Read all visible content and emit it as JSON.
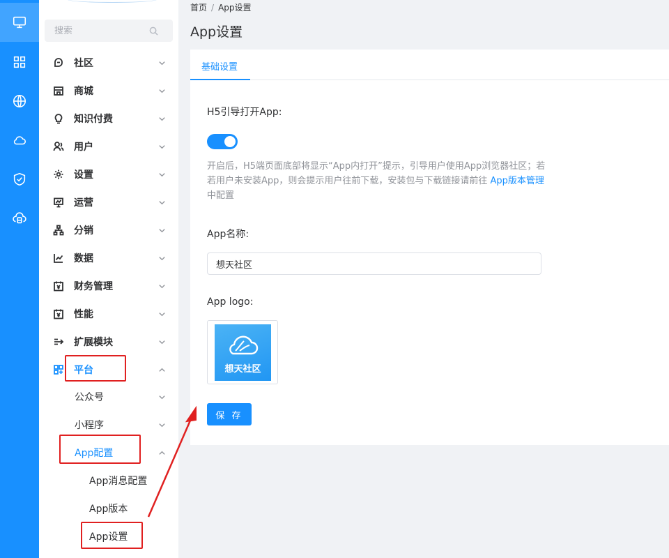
{
  "rail": {
    "items": [
      {
        "icon": "monitor-icon",
        "active": true
      },
      {
        "icon": "grid-icon"
      },
      {
        "icon": "globe-icon"
      },
      {
        "icon": "cloud-icon"
      },
      {
        "icon": "shield-check-icon"
      },
      {
        "icon": "cloud-server-icon"
      }
    ]
  },
  "sidebar": {
    "search_placeholder": "搜索",
    "items": [
      {
        "label": "社区",
        "icon": "chat-bubble-icon"
      },
      {
        "label": "商城",
        "icon": "store-icon"
      },
      {
        "label": "知识付费",
        "icon": "lightbulb-icon"
      },
      {
        "label": "用户",
        "icon": "users-icon"
      },
      {
        "label": "设置",
        "icon": "gear-icon"
      },
      {
        "label": "运营",
        "icon": "presentation-icon"
      },
      {
        "label": "分销",
        "icon": "org-chart-icon"
      },
      {
        "label": "数据",
        "icon": "line-chart-icon"
      },
      {
        "label": "财务管理",
        "icon": "calendar-yen-icon"
      },
      {
        "label": "性能",
        "icon": "calendar-yen-icon"
      },
      {
        "label": "扩展模块",
        "icon": "extend-icon"
      },
      {
        "label": "平台",
        "icon": "platform-icon",
        "active": true,
        "expanded": true
      }
    ],
    "platform_children": [
      {
        "label": "公众号"
      },
      {
        "label": "小程序"
      },
      {
        "label": "App配置",
        "active": true,
        "expanded": true
      }
    ],
    "app_config_children": [
      {
        "label": "App消息配置"
      },
      {
        "label": "App版本"
      },
      {
        "label": "App设置",
        "active": true
      }
    ]
  },
  "breadcrumb": {
    "home": "首页",
    "separator": "/",
    "current": "App设置"
  },
  "page_title": "App设置",
  "tabs": [
    {
      "label": "基础设置",
      "active": true
    }
  ],
  "form": {
    "h5_label": "H5引导打开App:",
    "h5_switch_on": true,
    "help_before_link": "开启后，H5端页面底部将显示“App内打开”提示，引导用户使用App浏览器社区；若若用户未安装App，则会提示用户往前下载，安装包与下载链接请前往 ",
    "help_link": "App版本管理",
    "help_after_link": " 中配置",
    "name_label": "App名称:",
    "name_value": "想天社区",
    "logo_label": "App logo:",
    "logo_text": "想天社区",
    "save_label": "保 存"
  },
  "colors": {
    "accent": "#1890ff",
    "highlight_box": "#e02020"
  }
}
